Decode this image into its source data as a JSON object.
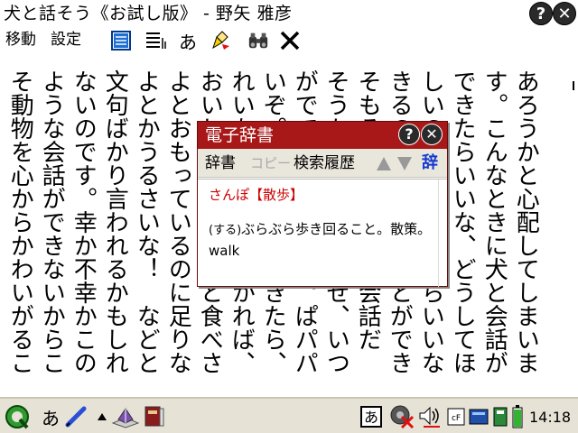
{
  "window": {
    "title": "犬と話そう《お試し版》 - 野矢 雅彦",
    "help_label": "?",
    "close_label": "✕"
  },
  "menu": {
    "move": "移動",
    "settings": "設定",
    "kana_tool": "あ"
  },
  "reader": {
    "columns": [
      "あろうかと心配してしまいま",
      "す。こんなときに犬と会話が",
      "できたらいいな、どうしてほ",
      "しいのか、わかったらいいな",
      "きるのに、ということができ",
      "そもそも人と人との会話だ",
      "そうかな。でも、なぜ、いつ",
      "がでてくるのだろう。ぱパパ",
      "いぞ。犬と会話ができたら、",
      "れいなところが見つかれば、",
      "おいしいものをもっと食べさ",
      "よとおもっているのに足りな",
      "よとかうるさいな！　などと",
      "文句ばかり言われるかもしれ",
      "ないのです。幸か不幸かこの",
      "ような会話ができないからこ",
      "そ動物を心からかわいがるこ"
    ]
  },
  "dictionary": {
    "title": "電子辞書",
    "help_label": "?",
    "close_label": "✕",
    "toolbar": {
      "jisho": "辞書",
      "copy": "コピー",
      "history": "検索履歴",
      "ji": "辞"
    },
    "entry_head": "さんぽ【散歩】",
    "entry_tag": "(する)",
    "entry_def": "ぶらぶら歩き回ること。散策。walk"
  },
  "taskbar": {
    "kana": "あ",
    "kana_ime": "あ",
    "cf_label": "cF",
    "clock": "14:18"
  },
  "colors": {
    "dict_title_bg": "#a81818",
    "dict_head_text": "#cc0000",
    "ji_button": "#1438d0",
    "taskbar_bg": "#e6e2d6"
  }
}
